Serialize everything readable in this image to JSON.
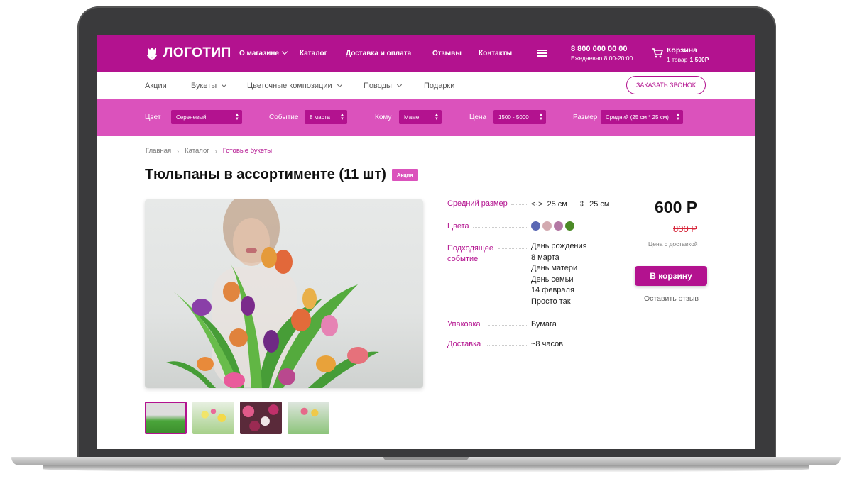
{
  "header": {
    "logo": "ЛОГОТИП",
    "nav": [
      "О магазине",
      "Каталог",
      "Доставка и оплата",
      "Отзывы",
      "Контакты"
    ],
    "phone": "8 800 000 00 00",
    "hours": "Ежедневно 8:00-20:00",
    "cart_title": "Корзина",
    "cart_count": "1 товар",
    "cart_total": "1 500Р"
  },
  "subnav": {
    "items": [
      "Акции",
      "Букеты",
      "Цветочные композиции",
      "Поводы",
      "Подарки"
    ],
    "call_button": "ЗАКАЗАТЬ ЗВОНОК"
  },
  "filters": [
    {
      "label": "Цвет",
      "value": "Сереневый"
    },
    {
      "label": "Событие",
      "value": "8 марта"
    },
    {
      "label": "Кому",
      "value": "Маме"
    },
    {
      "label": "Цена",
      "value": "1500 - 5000"
    },
    {
      "label": "Размер",
      "value": "Средний (25 см * 25 см)"
    }
  ],
  "breadcrumb": [
    "Главная",
    "Каталог",
    "Готовые букеты"
  ],
  "product": {
    "title": "Тюльпаны в ассортименте (11 шт)",
    "badge": "Акция",
    "specs": {
      "size_label": "Средний размер",
      "width": "25 см",
      "height": "25 см",
      "colors_label": "Цвета",
      "colors": [
        "#5b68b4",
        "#d3aab0",
        "#b378a4",
        "#4c8a26"
      ],
      "occasion_label_1": "Подходящее",
      "occasion_label_2": "событие",
      "occasions": [
        "День рождения",
        "8 марта",
        "День матери",
        "День семьи",
        "14 февраля",
        "Просто так"
      ],
      "packaging_label": "Упаковка",
      "packaging": "Бумага",
      "delivery_label": "Доставка",
      "delivery": "~8 часов"
    },
    "price": "600 Р",
    "old_price": "800 Р",
    "price_note": "Цена с доставкой",
    "buy_button": "В корзину",
    "review_link": "Оставить отзыв"
  },
  "colors": {
    "brand": "#b3128f",
    "filter_bar": "#db52bc",
    "old_price": "#d6263a"
  }
}
